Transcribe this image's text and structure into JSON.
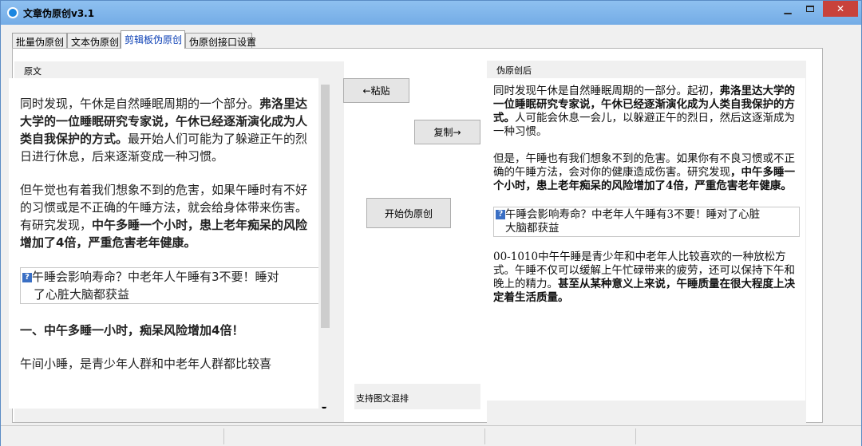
{
  "window": {
    "title": "文章伪原创v3.1",
    "controls": {
      "minimize": "▁",
      "close": "✕"
    }
  },
  "tabs": [
    {
      "label": "批量伪原创",
      "active": false
    },
    {
      "label": "文本伪原创",
      "active": false
    },
    {
      "label": "剪辑板伪原创",
      "active": true
    },
    {
      "label": "伪原创接口设置",
      "active": false
    }
  ],
  "original": {
    "label": "原文",
    "p1_normal": "同时发现，午休是自然睡眠周期的一个部分。",
    "p1_bold": "弗洛里达大学的一位睡眠研究专家说，午休已经逐渐演化成为人类自我保护的方式。",
    "p1_tail": "最开始人们可能为了躲避正午的烈日进行休息，后来逐渐变成一种习惯。",
    "p2_normal": "但午觉也有着我们想象不到的危害，如果午睡时有不好的习惯或是不正确的午睡方法，就会给身体带来伤害。有研究发现，",
    "p2_bold": "中午多睡一个小时，患上老年痴呆的风险增加了4倍，严重危害老年健康。",
    "card_line1": "午睡会影响寿命？中老年人午睡有3不要！睡对",
    "card_line2": "了心脏大脑都获益",
    "heading": "一、中午多睡一小时，痴呆风险增加4倍！",
    "p3": "午间小睡，是青少年人群和中老年人群都比较喜"
  },
  "buttons": {
    "paste": "←粘贴",
    "copy": "复制→",
    "start": "开始伪原创"
  },
  "mixed_note": "支持图文混排",
  "rewritten": {
    "label": "伪原创后",
    "p1_normal": "同时发现午休是自然睡眠周期的一部分。起初，",
    "p1_bold": "弗洛里达大学的一位睡眠研究专家说，午休已经逐渐演化成为人类自我保护的方式。",
    "p1_tail": "人可能会休息一会儿，以躲避正午的烈日，然后这逐渐成为一种习惯。",
    "p2_normal": "但是，午睡也有我们想象不到的危害。如果你有不良习惯或不正确的午睡方法，会对你的健康造成伤害。研究发现",
    "p2_bold": "，中午多睡一个小时，患上老年痴呆的风险增加了4倍，严重危害老年健康。",
    "card_line1": "午睡会影响寿命？中老年人午睡有3不要！睡对了心脏",
    "card_line2": "大脑都获益",
    "p3_normal": "00-1010中午午睡是青少年和中老年人比较喜欢的一种放松方式。午睡不仅可以缓解上午忙碌带来的疲劳，还可以保持下午和晚上的精力。",
    "p3_bold": "甚至从某种意义上来说，午睡质量在很大程度上决定着生活质量。"
  },
  "colors": {
    "titlebar": "#7fb4ea",
    "close_button": "#c8423b",
    "active_tab_text": "#0b3fb5",
    "window_bg": "#f0f0f0"
  },
  "icons": {
    "app": "app-icon",
    "link_card": "question-mark-icon"
  }
}
